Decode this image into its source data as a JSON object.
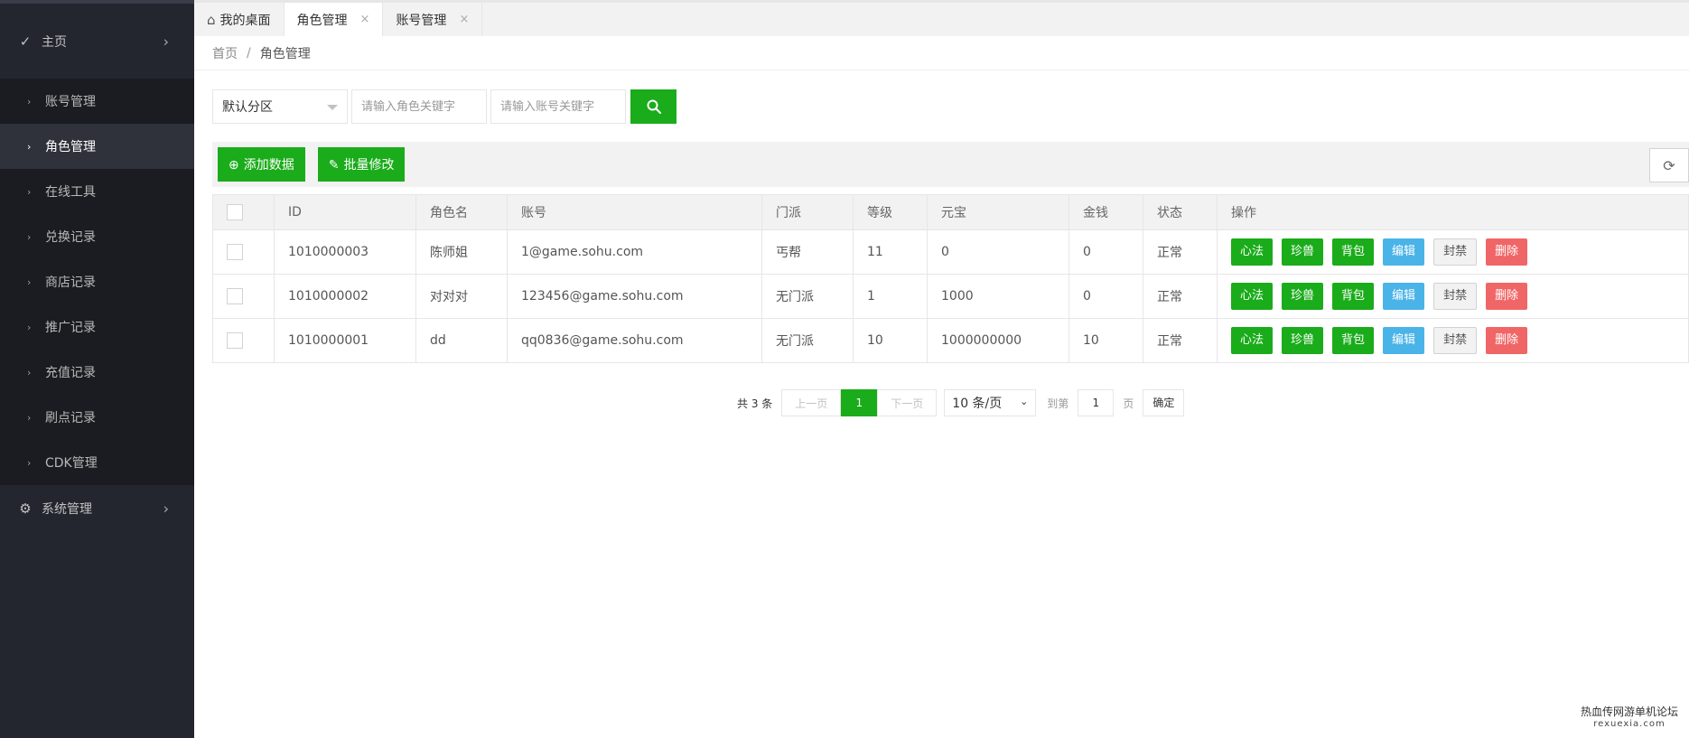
{
  "sidebar": {
    "home": {
      "label": "主页"
    },
    "items": [
      {
        "label": "账号管理",
        "active": false
      },
      {
        "label": "角色管理",
        "active": true
      },
      {
        "label": "在线工具",
        "active": false
      },
      {
        "label": "兑换记录",
        "active": false
      },
      {
        "label": "商店记录",
        "active": false
      },
      {
        "label": "推广记录",
        "active": false
      },
      {
        "label": "充值记录",
        "active": false
      },
      {
        "label": "刷点记录",
        "active": false
      },
      {
        "label": "CDK管理",
        "active": false
      }
    ],
    "system": {
      "label": "系统管理"
    }
  },
  "tabs": [
    {
      "label": "我的桌面"
    },
    {
      "label": "角色管理",
      "close": "×"
    },
    {
      "label": "账号管理",
      "close": "×"
    }
  ],
  "breadcrumb": {
    "home": "首页",
    "sep": "/",
    "current": "角色管理"
  },
  "filter": {
    "zone": "默认分区",
    "role_placeholder": "请输入角色关键字",
    "account_placeholder": "请输入账号关键字"
  },
  "toolbar": {
    "add_label": "添加数据",
    "batch_label": "批量修改"
  },
  "table": {
    "columns": [
      "ID",
      "角色名",
      "账号",
      "门派",
      "等级",
      "元宝",
      "金钱",
      "状态",
      "操作"
    ],
    "rows": [
      {
        "id": "1010000003",
        "name": "陈师姐",
        "account": "1@game.sohu.com",
        "faction": "丐帮",
        "level": "11",
        "yuanbao": "0",
        "money": "0",
        "status": "正常"
      },
      {
        "id": "1010000002",
        "name": "对对对",
        "account": "123456@game.sohu.com",
        "faction": "无门派",
        "level": "1",
        "yuanbao": "1000",
        "money": "0",
        "status": "正常"
      },
      {
        "id": "1010000001",
        "name": "dd",
        "account": "qq0836@game.sohu.com",
        "faction": "无门派",
        "level": "10",
        "yuanbao": "1000000000",
        "money": "10",
        "status": "正常"
      }
    ],
    "actions": {
      "xinfa": "心法",
      "zhenshou": "珍兽",
      "beibao": "背包",
      "edit": "编辑",
      "ban": "封禁",
      "delete": "删除"
    }
  },
  "pager": {
    "total": "共 3 条",
    "prev": "上一页",
    "current": "1",
    "next": "下一页",
    "page_size": "10 条/页",
    "goto": "到第",
    "goto_value": "1",
    "page_unit": "页",
    "confirm": "确定"
  },
  "watermark": {
    "line1": "热血传网游单机论坛",
    "line2": "rexuexia.com"
  },
  "colors": {
    "sidebar_bg": "#23262e",
    "accent_green": "#1aac1a",
    "edit_blue": "#4ab3e8",
    "delete_red": "#f06666"
  }
}
